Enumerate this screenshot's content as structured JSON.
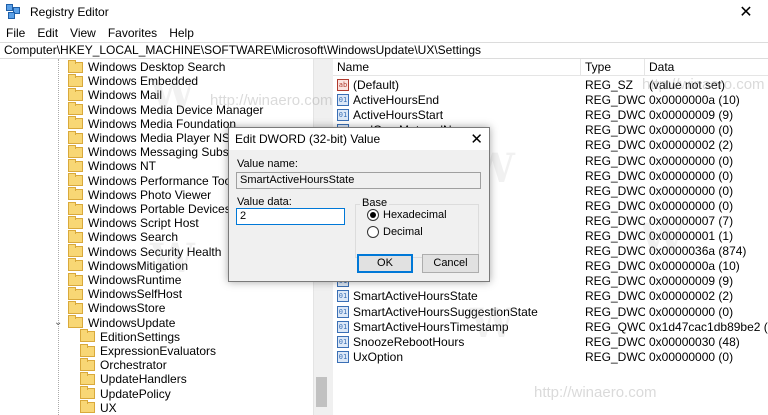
{
  "window": {
    "title": "Registry Editor",
    "close_glyph": "✕"
  },
  "menu": [
    "File",
    "Edit",
    "View",
    "Favorites",
    "Help"
  ],
  "address": "Computer\\HKEY_LOCAL_MACHINE\\SOFTWARE\\Microsoft\\WindowsUpdate\\UX\\Settings",
  "tree": {
    "items": [
      {
        "label": "Windows Desktop Search",
        "depth": 0
      },
      {
        "label": "Windows Embedded",
        "depth": 0
      },
      {
        "label": "Windows Mail",
        "depth": 0
      },
      {
        "label": "Windows Media Device Manager",
        "depth": 0
      },
      {
        "label": "Windows Media Foundation",
        "depth": 0
      },
      {
        "label": "Windows Media Player NSS",
        "depth": 0
      },
      {
        "label": "Windows Messaging Subsystem",
        "depth": 0
      },
      {
        "label": "Windows NT",
        "depth": 0
      },
      {
        "label": "Windows Performance Toolkit",
        "depth": 0
      },
      {
        "label": "Windows Photo Viewer",
        "depth": 0
      },
      {
        "label": "Windows Portable Devices",
        "depth": 0
      },
      {
        "label": "Windows Script Host",
        "depth": 0
      },
      {
        "label": "Windows Search",
        "depth": 0
      },
      {
        "label": "Windows Security Health",
        "depth": 0
      },
      {
        "label": "WindowsMitigation",
        "depth": 0
      },
      {
        "label": "WindowsRuntime",
        "depth": 0
      },
      {
        "label": "WindowsSelfHost",
        "depth": 0
      },
      {
        "label": "WindowsStore",
        "depth": 0
      },
      {
        "label": "WindowsUpdate",
        "depth": 0,
        "expanded": true
      },
      {
        "label": "EditionSettings",
        "depth": 1
      },
      {
        "label": "ExpressionEvaluators",
        "depth": 1
      },
      {
        "label": "Orchestrator",
        "depth": 1
      },
      {
        "label": "UpdateHandlers",
        "depth": 1
      },
      {
        "label": "UpdatePolicy",
        "depth": 1
      },
      {
        "label": "UX",
        "depth": 1
      }
    ]
  },
  "list": {
    "columns": {
      "name": "Name",
      "type": "Type",
      "data": "Data"
    },
    "rows": [
      {
        "name": "(Default)",
        "type": "REG_SZ",
        "data": "(value not set)",
        "icon": "string-value-icon"
      },
      {
        "name": "ActiveHoursEnd",
        "type": "REG_DWORD",
        "data": "0x0000000a (10)",
        "icon": "binary-value-icon"
      },
      {
        "name": "ActiveHoursStart",
        "type": "REG_DWORD",
        "data": "0x00000009 (9)",
        "icon": "binary-value-icon"
      },
      {
        "name": "oadOverMeteredN...",
        "type": "REG_DWORD",
        "data": "0x00000000 (0)",
        "icon": "binary-value-icon"
      },
      {
        "name": "",
        "type": "REG_DWORD",
        "data": "0x00000002 (2)",
        "icon": "binary-value-icon"
      },
      {
        "name": "s",
        "type": "REG_DWORD",
        "data": "0x00000000 (0)",
        "icon": "binary-value-icon"
      },
      {
        "name": "",
        "type": "REG_DWORD",
        "data": "0x00000000 (0)",
        "icon": "binary-value-icon"
      },
      {
        "name": "",
        "type": "REG_DWORD",
        "data": "0x00000000 (0)",
        "icon": "binary-value-icon"
      },
      {
        "name": "",
        "type": "REG_DWORD",
        "data": "0x00000000 (0)",
        "icon": "binary-value-icon"
      },
      {
        "name": "",
        "type": "REG_DWORD",
        "data": "0x00000007 (7)",
        "icon": "binary-value-icon"
      },
      {
        "name": "",
        "type": "REG_DWORD",
        "data": "0x00000001 (1)",
        "icon": "binary-value-icon"
      },
      {
        "name": "",
        "type": "REG_DWORD",
        "data": "0x0000036a (874)",
        "icon": "binary-value-icon"
      },
      {
        "name": "",
        "type": "REG_DWORD",
        "data": "0x0000000a (10)",
        "icon": "binary-value-icon"
      },
      {
        "name": "",
        "type": "REG_DWORD",
        "data": "0x00000009 (9)",
        "icon": "binary-value-icon"
      },
      {
        "name": "SmartActiveHoursState",
        "type": "REG_DWORD",
        "data": "0x00000002 (2)",
        "icon": "binary-value-icon"
      },
      {
        "name": "SmartActiveHoursSuggestionState",
        "type": "REG_DWORD",
        "data": "0x00000000 (0)",
        "icon": "binary-value-icon"
      },
      {
        "name": "SmartActiveHoursTimestamp",
        "type": "REG_QWO...",
        "data": "0x1d47cac1db89be2 (1318673",
        "icon": "binary-value-icon"
      },
      {
        "name": "SnoozeRebootHours",
        "type": "REG_DWORD",
        "data": "0x00000030 (48)",
        "icon": "binary-value-icon"
      },
      {
        "name": "UxOption",
        "type": "REG_DWORD",
        "data": "0x00000000 (0)",
        "icon": "binary-value-icon"
      }
    ]
  },
  "dialog": {
    "title": "Edit DWORD (32-bit) Value",
    "value_name_label": "Value name:",
    "value_name": "SmartActiveHoursState",
    "value_data_label": "Value data:",
    "value_data": "2",
    "base_label": "Base",
    "hex_label": "Hexadecimal",
    "dec_label": "Decimal",
    "ok_label": "OK",
    "cancel_label": "Cancel",
    "selected_base": "hex"
  },
  "watermark": {
    "logo": "W",
    "url": "http://winaero.com"
  }
}
